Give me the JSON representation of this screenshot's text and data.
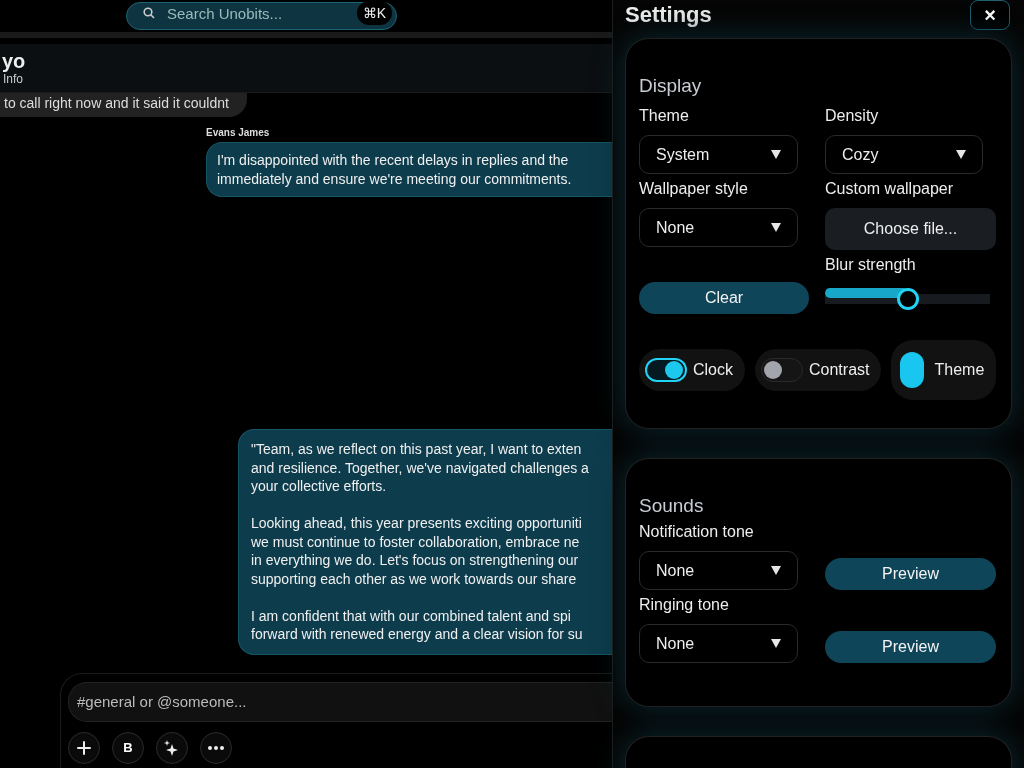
{
  "search": {
    "placeholder": "Search Unobits...",
    "shortcut": "⌘K"
  },
  "conversation": {
    "title": "yo",
    "subtitle": "Info"
  },
  "messages": [
    {
      "kind": "received",
      "text": "to call right now and it said it couldnt"
    },
    {
      "kind": "sent",
      "author": "Evans James",
      "text": "I'm disappointed with the recent delays in replies and the\nimmediately and ensure we're meeting our commitments."
    },
    {
      "kind": "sent",
      "text": "\"Team, as we reflect on this past year, I want to exten\nand resilience. Together, we've navigated challenges a\nyour collective efforts.\n\nLooking ahead, this year presents exciting opportuniti\nwe must continue to foster collaboration, embrace ne\nin everything we do. Let's focus on strengthening our\nsupporting each other as we work towards our share\n\nI am confident that with our combined talent and spi\nforward with renewed energy and a clear vision for su"
    }
  ],
  "composer": {
    "placeholder": "#general or @someone...",
    "tools": [
      {
        "kind": "add"
      },
      {
        "kind": "bold",
        "label": "B"
      },
      {
        "kind": "sparkle"
      },
      {
        "kind": "more"
      }
    ]
  },
  "settings": {
    "title": "Settings",
    "close": "×",
    "display": {
      "heading": "Display",
      "theme": {
        "label": "Theme",
        "value": "System"
      },
      "density": {
        "label": "Density",
        "value": "Cozy"
      },
      "wallpaper_style": {
        "label": "Wallpaper style",
        "value": "None"
      },
      "custom_wallpaper": {
        "label": "Custom wallpaper",
        "button": "Choose file..."
      },
      "clear": "Clear",
      "blur": {
        "label": "Blur strength",
        "level": 0.5
      },
      "toggles": [
        {
          "kind": "switch",
          "label": "Clock",
          "on": true
        },
        {
          "kind": "switch",
          "label": "Contrast",
          "on": false
        },
        {
          "kind": "pill",
          "label": "Theme",
          "on": true
        }
      ]
    },
    "sounds": {
      "heading": "Sounds",
      "tones": [
        {
          "label": "Notification tone",
          "value": "None",
          "button": "Preview"
        },
        {
          "label": "Ringing tone",
          "value": "None",
          "button": "Preview"
        }
      ]
    }
  }
}
